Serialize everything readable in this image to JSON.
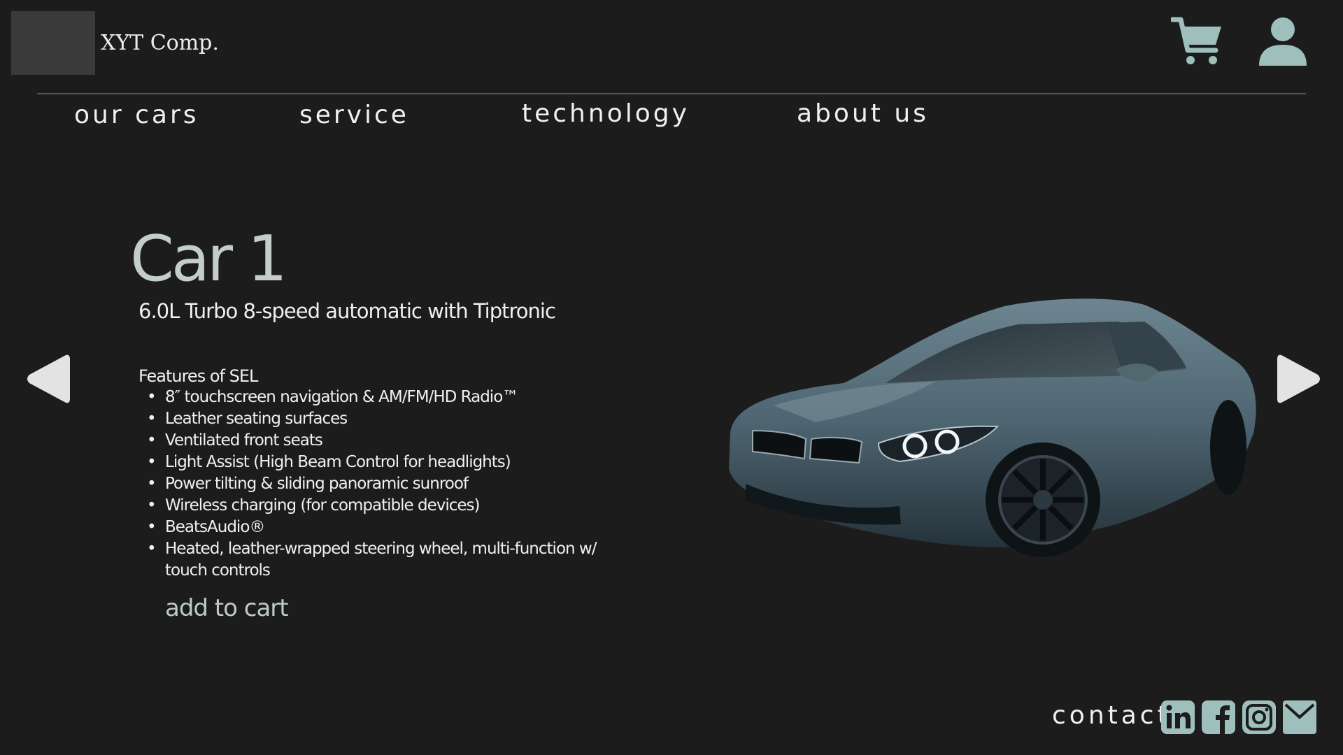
{
  "header": {
    "brand": "XYT Comp.",
    "accent_color": "#9fbfbd",
    "icons": [
      "cart-icon",
      "user-icon"
    ]
  },
  "nav": {
    "items": [
      {
        "label": "our cars"
      },
      {
        "label": "service"
      },
      {
        "label": "technology"
      },
      {
        "label": "about us"
      }
    ]
  },
  "product": {
    "title": "Car 1",
    "subtitle": "6.0L Turbo 8-speed automatic with Tiptronic",
    "features_heading": "Features of SEL",
    "features": [
      "8″ touchscreen navigation & AM/FM/HD Radio™",
      "Leather seating surfaces",
      "Ventilated front seats",
      "Light Assist (High Beam Control for headlights)",
      "Power tilting & sliding panoramic sunroof",
      "Wireless charging (for compatible devices)",
      "BeatsAudio®",
      "Heated, leather-wrapped steering wheel, multi-function w/ touch controls"
    ],
    "add_to_cart": "add to cart",
    "image": "car-image"
  },
  "carousel": {
    "prev_icon": "arrow-left-icon",
    "next_icon": "arrow-right-icon"
  },
  "footer": {
    "contact": "contact",
    "socials": [
      "linkedin-icon",
      "facebook-icon",
      "instagram-icon",
      "mail-icon"
    ]
  }
}
